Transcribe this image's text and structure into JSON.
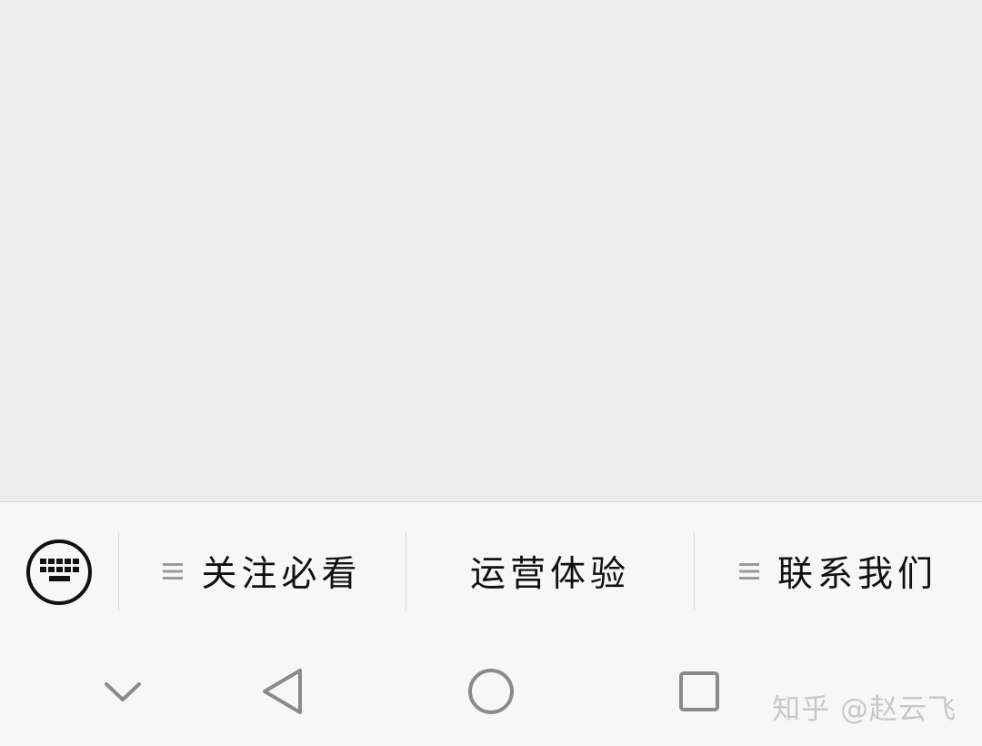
{
  "menu": {
    "items": [
      {
        "label": "关注必看",
        "has_submenu": true
      },
      {
        "label": "运营体验",
        "has_submenu": false
      },
      {
        "label": "联系我们",
        "has_submenu": true
      }
    ]
  },
  "watermark": {
    "text": "知乎 @赵云飞"
  },
  "icons": {
    "keyboard": "keyboard-icon",
    "submenu": "submenu-lines-icon",
    "nav_collapse": "chevron-down-icon",
    "nav_back": "back-triangle-icon",
    "nav_home": "home-circle-icon",
    "nav_recents": "recents-square-icon"
  },
  "colors": {
    "content_bg": "#ededed",
    "bar_bg": "#f7f7f7",
    "text": "#111111",
    "nav_icon": "#8a8a8a"
  }
}
